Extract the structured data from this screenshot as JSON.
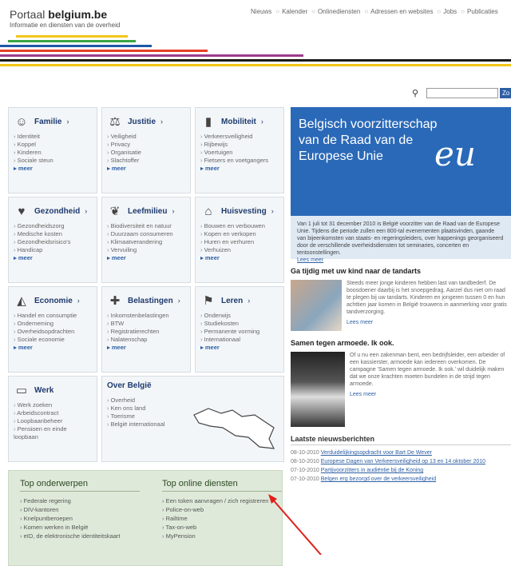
{
  "header": {
    "site_name_prefix": "Portaal ",
    "site_name": "belgium.be",
    "tagline": "Informatie en diensten van de overheid",
    "nav": [
      "Nieuws",
      "Kalender",
      "Onlinediensten",
      "Adressen en websites",
      "Jobs",
      "Publicaties"
    ],
    "search_button": "Zo",
    "stripe_colors": [
      "#f4c518",
      "#3aa646",
      "#1d58a8",
      "#e5402c",
      "#9c3c8c",
      "#1a1a1a"
    ]
  },
  "themes": [
    {
      "title": "Familie",
      "icon": "family-icon",
      "items": [
        "Identiteit",
        "Koppel",
        "Kinderen",
        "Sociale steun"
      ],
      "more": "meer"
    },
    {
      "title": "Justitie",
      "icon": "justice-icon",
      "items": [
        "Veiligheid",
        "Privacy",
        "Organisatie",
        "Slachtoffer"
      ],
      "more": "meer"
    },
    {
      "title": "Mobiliteit",
      "icon": "traffic-light-icon",
      "items": [
        "Verkeersveiligheid",
        "Rijbewijs",
        "Voertuigen",
        "Fietsers en voetgangers"
      ],
      "more": "meer"
    },
    {
      "title": "Gezondheid",
      "icon": "heart-icon",
      "items": [
        "Gezondheidszorg",
        "Medische kosten",
        "Gezondheidsrisico's",
        "Handicap"
      ],
      "more": "meer"
    },
    {
      "title": "Leefmilieu",
      "icon": "leaf-icon",
      "items": [
        "Biodiversiteit en natuur",
        "Duurzaam consumeren",
        "Klimaatverandering",
        "Vervuiling"
      ],
      "more": "meer"
    },
    {
      "title": "Huisvesting",
      "icon": "house-icon",
      "items": [
        "Bouwen en verbouwen",
        "Kopen en verkopen",
        "Huren en verhuren",
        "Verhuizen"
      ],
      "more": "meer"
    },
    {
      "title": "Economie",
      "icon": "economy-icon",
      "items": [
        "Handel en consumptie",
        "Onderneming",
        "Overheidsopdrachten",
        "Sociale economie"
      ],
      "more": "meer"
    },
    {
      "title": "Belastingen",
      "icon": "tax-icon",
      "items": [
        "Inkomstenbelastingen",
        "BTW",
        "Registratierechten",
        "Nalatenschap"
      ],
      "more": "meer"
    },
    {
      "title": "Leren",
      "icon": "flag-icon",
      "items": [
        "Onderwijs",
        "Studiekosten",
        "Permanente vorming",
        "Internationaal"
      ],
      "more": "meer"
    }
  ],
  "werk": {
    "title": "Werk",
    "items": [
      "Werk zoeken",
      "Arbeidscontract",
      "Loopbaanbeheer",
      "Pensioen en einde loopbaan"
    ]
  },
  "over": {
    "title": "Over België",
    "items": [
      "Overheid",
      "Ken ons land",
      "Toerisme",
      "België internationaal"
    ]
  },
  "top": {
    "subjects_title": "Top onderwerpen",
    "subjects": [
      "Federale regering",
      "DIV-kantoren",
      "Knelpuntberoepen",
      "Komen werken in België",
      "eID, de elektronische identiteitskaart"
    ],
    "services_title": "Top online diensten",
    "services": [
      "Een token aanvragen / zich registreren",
      "Police-on-web",
      "Railtime",
      "Tax-on-web",
      "MyPension"
    ]
  },
  "banner": {
    "title": "Belgisch voorzitterschap van de Raad van de Europese Unie",
    "eu": "eu",
    "intro": "Van 1 juli tot 31 december 2010 is België voorzitter van de Raad van de Europese Unie. Tijdens die periode zullen een 800-tal evenementen plaatsvinden, gaande van bijeenkomsten van staats- en regeringsleiders, over happenings georganiseerd door de verschillende overheidsdiensten tot seminaries, concerten en tentoonstellingen.",
    "more": "Lees meer"
  },
  "news": [
    {
      "title": "Ga tijdig met uw kind naar de tandarts",
      "text": "Steeds meer jonge kinderen hebben last van tandbederf. De boosdoener daarbij is het snoepgedrag. Aarzel dus niet om raad te plegen bij uw tandarts. Kinderen en jongeren tussen 0 en hun achttien jaar komen in België trouwens in aanmerking voor gratis tandverzorging.",
      "more": "Lees meer"
    },
    {
      "title": "Samen tegen armoede. Ik ook.",
      "text": "Of u nu een zakenman bent, een bedrijfsleider, een arbeider of een kassierster, armoede kan iedereen overkomen. De campagne 'Samen tegen armoede. Ik ook.' wil duidelijk maken dat we onze krachten moeten bundelen in de strijd tegen armoede.",
      "more": "Lees meer"
    }
  ],
  "latest": {
    "title": "Laatste nieuwsberichten",
    "items": [
      {
        "date": "08-10-2010",
        "text": "Verduidelijkingsopdracht voor Bart De Wever"
      },
      {
        "date": "08-10-2010",
        "text": "Europese Dagen van Verkeersveiligheid op 13 en 14 oktober 2010"
      },
      {
        "date": "07-10-2010",
        "text": "Partijvoorzitters in audiëntie bij de Koning"
      },
      {
        "date": "07-10-2010",
        "text": "Belgen erg bezorgd over de verkeersveiligheid"
      }
    ]
  }
}
